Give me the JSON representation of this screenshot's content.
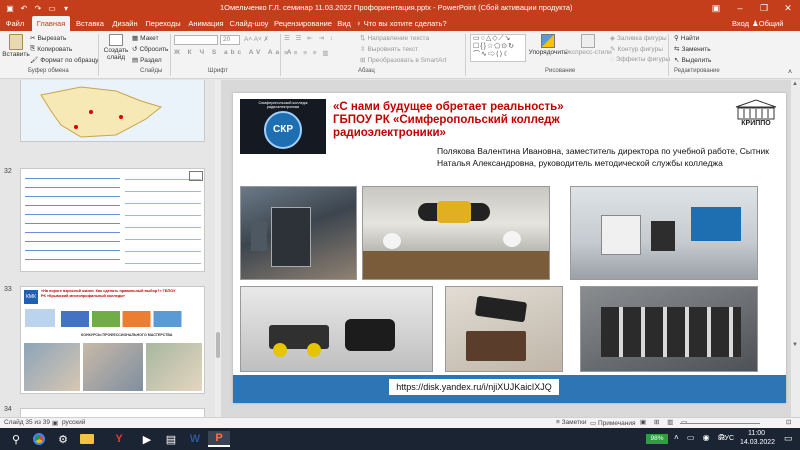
{
  "titlebar": {
    "text": "1Омельченко Г.Л. семинар 11.03.2022 Профориентация.pptx - PowerPoint (Сбой активации продукта)",
    "save_icon": "save-icon",
    "undo_icon": "undo-icon",
    "redo_icon": "redo-icon",
    "bg": "#c43e1c"
  },
  "tabs": {
    "items": [
      "Файл",
      "Главная",
      "Вставка",
      "Дизайн",
      "Переходы",
      "Анимация",
      "Слайд-шоу",
      "Рецензирование",
      "Вид"
    ],
    "active": "Главная",
    "tell_me": "Что вы хотите сделать?",
    "sign_in": "Вход",
    "share": "Общий доступ"
  },
  "ribbon": {
    "clipboard": {
      "paste": "Вставить",
      "cut": "Вырезать",
      "copy": "Копировать",
      "format_painter": "Формат по образцу",
      "label": "Буфер обмена"
    },
    "slides": {
      "new_slide": "Создать слайд",
      "layout": "Макет",
      "reset": "Сбросить",
      "section": "Раздел",
      "label": "Слайды"
    },
    "font": {
      "size": "20",
      "label": "Шрифт"
    },
    "paragraph": {
      "text_direction": "Направление текста",
      "align_text": "Выровнять текст",
      "smartart": "Преобразовать в SmartArt",
      "label": "Абзац"
    },
    "drawing": {
      "arrange": "Упорядочить",
      "quick_styles": "Экспресс-стили",
      "fill": "Заливка фигуры",
      "outline": "Контур фигуры",
      "effects": "Эффекты фигуры",
      "label": "Рисование"
    },
    "editing": {
      "find": "Найти",
      "replace": "Заменить",
      "select": "Выделить",
      "label": "Редактирование"
    }
  },
  "thumbnails": [
    {
      "num": "32"
    },
    {
      "num": "33",
      "text": "«На пороге взрослой жизни. Как сделать правильный выбор?» ГБПОУ РК «Крымский многопрофильный колледж»",
      "sub": "КОНКУРСЫ ПРОФЕССИОНАЛЬНОГО МАСТЕРСТВА"
    },
    {
      "num": "34"
    }
  ],
  "slide": {
    "logo_caption": "Симферопольский колледж радиоэлектроники",
    "logo_text": "СКР",
    "title": "«С нами будущее обретает реальность» ГБПОУ РК «Симферопольский колледж радиоэлектроники»",
    "right_logo": "КРИППО",
    "authors": "Полякова Валентина Ивановна, заместитель директора по учебной работе, Сытник Наталья Александровна, руководитель методической службы колледжа",
    "url": "https://disk.yandex.ru/i/njiXUJKaicIXJQ",
    "accent": "#c00000",
    "bar_color": "#2e75b6"
  },
  "status": {
    "slide_info": "Слайд 35 из 39",
    "language": "русский",
    "notes": "Заметки",
    "comments": "Примечания"
  },
  "taskbar": {
    "battery": "98%",
    "lang": "РУС",
    "time": "11:00",
    "date": "14.03.2022"
  }
}
